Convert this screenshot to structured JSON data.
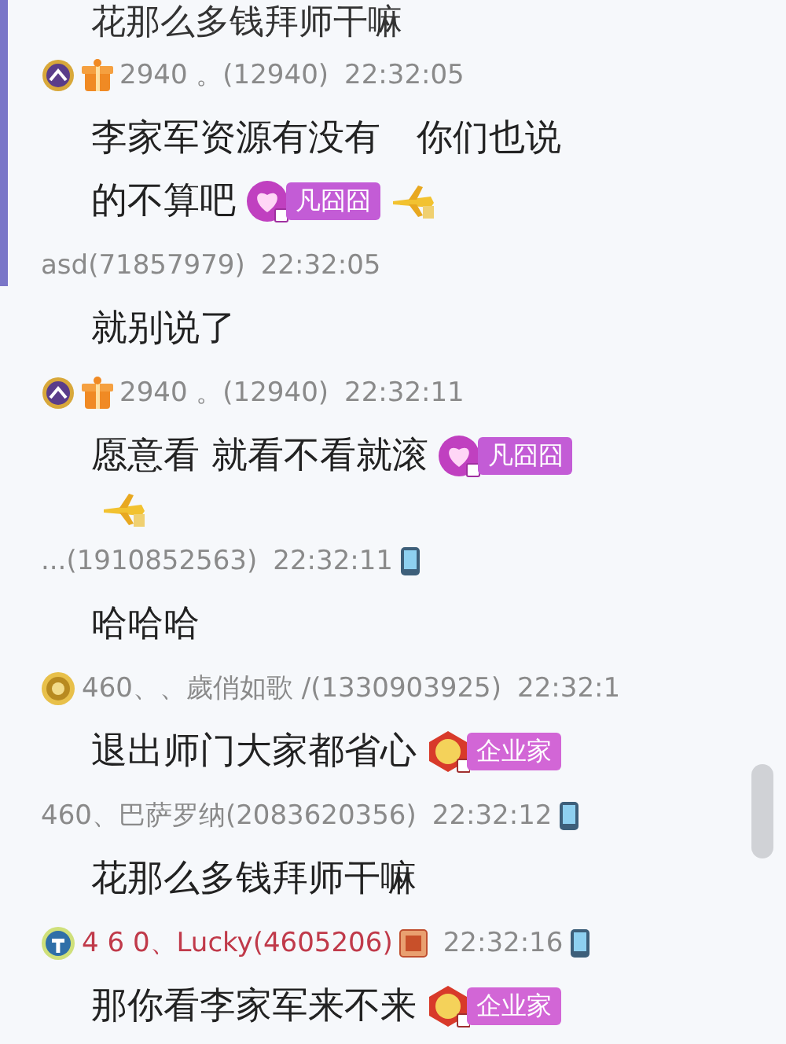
{
  "top_cut_text": "花那么多钱拜师干嘛",
  "messages": [
    {
      "badges": [
        {
          "kind": "crown"
        },
        {
          "kind": "gift"
        }
      ],
      "sender": "2940 。(12940)",
      "highlight": false,
      "role_badge": false,
      "time": "22:32:05",
      "mobile": false,
      "lines": [
        "李家军资源有没有　你们也说",
        "的不算吧"
      ],
      "tags": [
        {
          "kind": "heart",
          "label": "凡囧囧"
        },
        {
          "kind": "plane"
        }
      ]
    },
    {
      "sender": "asd(71857979)",
      "highlight": false,
      "role_badge": false,
      "time": "22:32:05",
      "mobile": false,
      "lines": [
        "就别说了"
      ]
    },
    {
      "badges": [
        {
          "kind": "crown"
        },
        {
          "kind": "gift"
        }
      ],
      "sender": "2940 。(12940)",
      "highlight": false,
      "role_badge": false,
      "time": "22:32:11",
      "mobile": false,
      "lines": [
        "愿意看 就看不看就滚"
      ],
      "tags": [
        {
          "kind": "heart",
          "label": "凡囧囧"
        },
        {
          "kind": "plane"
        }
      ]
    },
    {
      "sender": "...(1910852563)",
      "highlight": false,
      "role_badge": false,
      "time": "22:32:11",
      "mobile": true,
      "lines": [
        "哈哈哈"
      ]
    },
    {
      "badges": [
        {
          "kind": "coin"
        }
      ],
      "sender": "460、、歲俏如歌 ∕(1330903925)",
      "highlight": false,
      "role_badge": false,
      "time": "22:32:1",
      "mobile": false,
      "lines": [
        "退出师门大家都省心"
      ],
      "tags": [
        {
          "kind": "medal",
          "label": "企业家"
        }
      ]
    },
    {
      "sender": "460、巴萨罗纳(2083620356)",
      "highlight": false,
      "role_badge": false,
      "time": "22:32:12",
      "mobile": true,
      "lines": [
        "花那么多钱拜师干嘛"
      ]
    },
    {
      "badges": [
        {
          "kind": "shield"
        }
      ],
      "sender": "4 6 0、Lucky(4605206)",
      "highlight": true,
      "role_badge": true,
      "time": "22:32:16",
      "mobile": true,
      "lines": [
        "那你看李家军来不来"
      ],
      "tags": [
        {
          "kind": "medal",
          "label": "企业家"
        }
      ]
    }
  ]
}
